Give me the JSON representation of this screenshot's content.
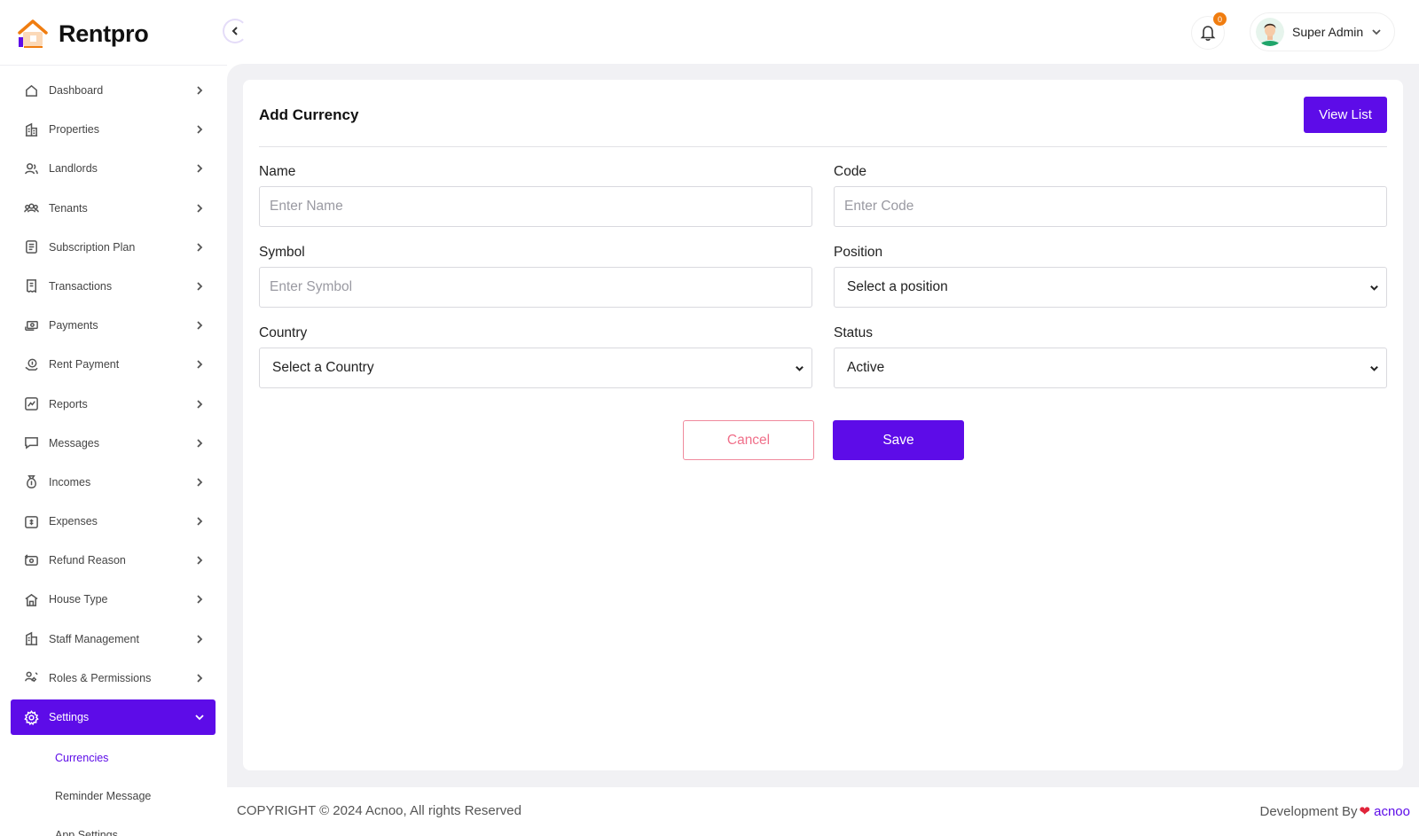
{
  "brand": {
    "name": "Rentpro"
  },
  "sidebar": {
    "items": [
      {
        "label": "Dashboard",
        "icon": "home-icon"
      },
      {
        "label": "Properties",
        "icon": "building-icon"
      },
      {
        "label": "Landlords",
        "icon": "users-icon"
      },
      {
        "label": "Tenants",
        "icon": "group-icon"
      },
      {
        "label": "Subscription Plan",
        "icon": "plan-icon"
      },
      {
        "label": "Transactions",
        "icon": "receipt-icon"
      },
      {
        "label": "Payments",
        "icon": "payment-icon"
      },
      {
        "label": "Rent Payment",
        "icon": "coin-hand-icon"
      },
      {
        "label": "Reports",
        "icon": "report-icon"
      },
      {
        "label": "Messages",
        "icon": "chat-icon"
      },
      {
        "label": "Incomes",
        "icon": "money-bag-icon"
      },
      {
        "label": "Expenses",
        "icon": "expense-icon"
      },
      {
        "label": "Refund Reason",
        "icon": "refund-icon"
      },
      {
        "label": "House Type",
        "icon": "house-type-icon"
      },
      {
        "label": "Staff Management",
        "icon": "staff-icon"
      },
      {
        "label": "Roles & Permissions",
        "icon": "roles-icon"
      },
      {
        "label": "Settings",
        "icon": "gear-icon",
        "active": true
      }
    ],
    "submenu": [
      {
        "label": "Currencies",
        "current": true
      },
      {
        "label": "Reminder Message"
      },
      {
        "label": "App Settings"
      }
    ]
  },
  "topbar": {
    "notification_count": "0",
    "user_name": "Super Admin"
  },
  "form": {
    "title": "Add Currency",
    "view_list_label": "View List",
    "name_label": "Name",
    "name_placeholder": "Enter Name",
    "code_label": "Code",
    "code_placeholder": "Enter Code",
    "symbol_label": "Symbol",
    "symbol_placeholder": "Enter Symbol",
    "position_label": "Position",
    "position_value": "Select a position",
    "country_label": "Country",
    "country_value": "Select a Country",
    "status_label": "Status",
    "status_value": "Active",
    "cancel_label": "Cancel",
    "save_label": "Save"
  },
  "footer": {
    "copyright": "COPYRIGHT © 2024 Acnoo, All rights Reserved",
    "dev_by": "Development By",
    "dev_brand": "acnoo"
  },
  "colors": {
    "accent": "#5d0ce8",
    "badge": "#f07d10",
    "cancel": "#f0708a",
    "content_bg": "#f1f1f4"
  }
}
